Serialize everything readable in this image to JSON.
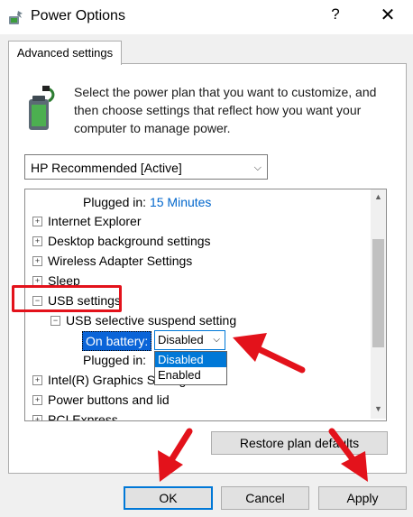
{
  "window": {
    "title": "Power Options",
    "help_glyph": "?",
    "close_glyph": "✕"
  },
  "tab": {
    "label": "Advanced settings"
  },
  "description": "Select the power plan that you want to customize, and then choose settings that reflect how you want your computer to manage power.",
  "plan_select": {
    "value": "HP Recommended [Active]",
    "caret": "⌵"
  },
  "tree": {
    "items": [
      {
        "label": "Plugged in:",
        "value": "15 Minutes"
      },
      {
        "expander": "+",
        "label": "Internet Explorer"
      },
      {
        "expander": "+",
        "label": "Desktop background settings"
      },
      {
        "expander": "+",
        "label": "Wireless Adapter Settings"
      },
      {
        "expander": "+",
        "label": "Sleep"
      },
      {
        "expander": "−",
        "label": "USB settings"
      },
      {
        "expander": "−",
        "label": "USB selective suspend setting"
      },
      {
        "label": "On battery:"
      },
      {
        "label": "Plugged in:"
      },
      {
        "expander": "+",
        "label": "Intel(R) Graphics Settings"
      },
      {
        "expander": "+",
        "label": "Power buttons and lid"
      },
      {
        "expander": "+",
        "label": "PCI Express"
      }
    ],
    "scroll_up": "▲",
    "scroll_down": "▼"
  },
  "usb_dropdown": {
    "value": "Disabled",
    "caret": "⌵",
    "options": [
      "Disabled",
      "Enabled"
    ]
  },
  "buttons": {
    "restore": "Restore plan defaults",
    "ok": "OK",
    "cancel": "Cancel",
    "apply": "Apply"
  },
  "colors": {
    "accent": "#0078d7",
    "annotation_red": "#e3121b",
    "link": "#0066cc"
  }
}
